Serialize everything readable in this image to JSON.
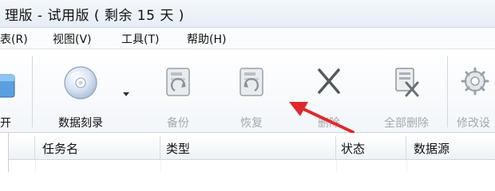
{
  "window": {
    "title": "理版 - 试用版 ( 剩余 15 天 )"
  },
  "menu": {
    "items": [
      {
        "label": "表(R)"
      },
      {
        "label": "视图(V)"
      },
      {
        "label": "工具(T)"
      },
      {
        "label": "帮助(H)"
      }
    ]
  },
  "toolbar": {
    "partial_label": "开",
    "burn": {
      "label": "数据刻录"
    },
    "backup": {
      "label": "备份"
    },
    "restore": {
      "label": "恢复"
    },
    "delete": {
      "label": "删除"
    },
    "delete_all": {
      "label": "全部删除"
    },
    "modify": {
      "label": "修改设"
    }
  },
  "table": {
    "columns": [
      "任务名",
      "类型",
      "状态",
      "数据源"
    ]
  },
  "colors": {
    "annotation_arrow": "#e0282a",
    "disabled_text": "#a5a9ae"
  }
}
